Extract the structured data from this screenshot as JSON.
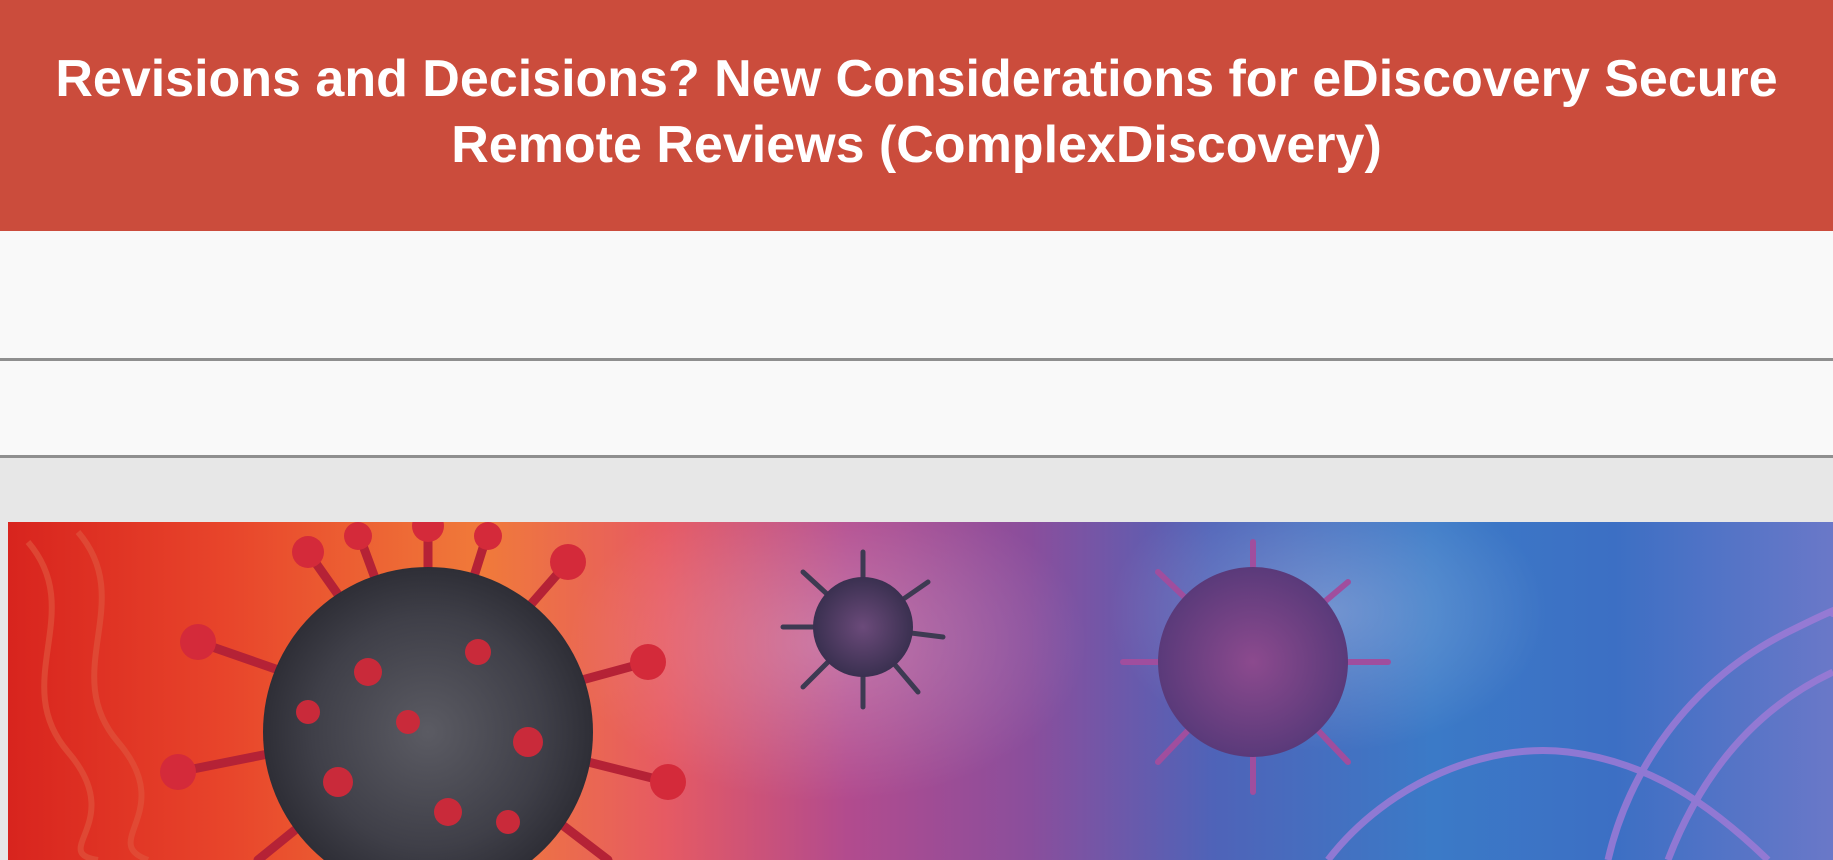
{
  "header": {
    "title_line_1": "Revisions and Decisions? New Considerations for eDiscovery Secure",
    "title_line_2": "Remote Reviews (ComplexDiscovery)",
    "background_color": "#cb4c3c",
    "text_color": "#ffffff"
  },
  "hero": {
    "kind": "photo-virus-illustration"
  }
}
